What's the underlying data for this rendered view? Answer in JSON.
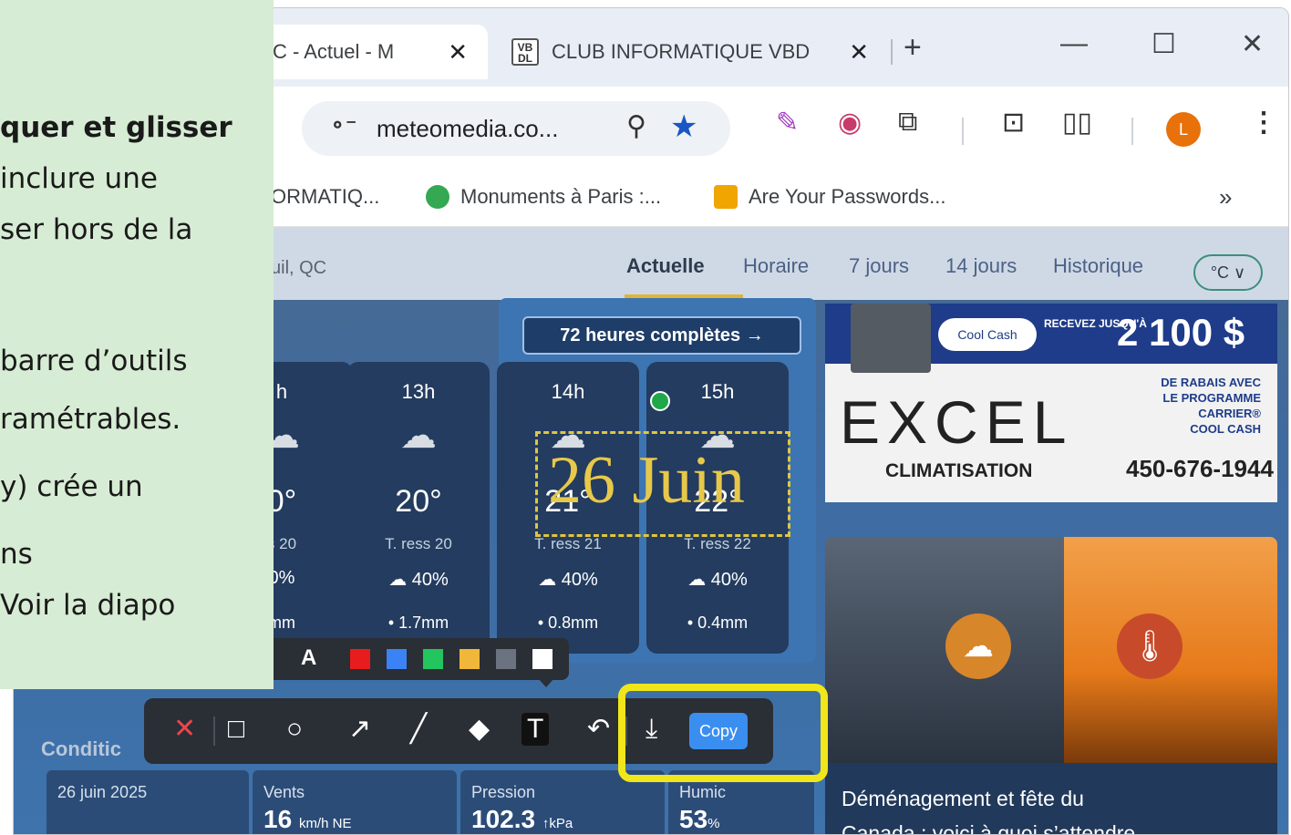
{
  "note": {
    "lines": [
      "quer et glisser",
      "inclure une",
      "ser hors de la",
      "barre d’outils",
      "ramétrables.",
      "y) crée un",
      "ns",
      "Voir la diapo"
    ]
  },
  "browser": {
    "tabs": [
      {
        "label": "C - Actuel - M"
      },
      {
        "label": "CLUB INFORMATIQUE VBD",
        "favicon_text": "VB DL"
      }
    ],
    "close_glyph": "✕",
    "new_tab_glyph": "+",
    "window_controls": {
      "minimize": "—",
      "maximize": "☐",
      "close": "✕"
    },
    "address": "meteomedia.co...",
    "profile_initial": "L",
    "bookmarks": [
      "ORMATIQ...",
      "Monuments à Paris :...",
      "Are Your Passwords..."
    ],
    "more_bookmarks": "»"
  },
  "weather": {
    "location": "uil, QC",
    "nav": [
      "Actuelle",
      "Horaire",
      "7 jours",
      "14 jours",
      "Historique"
    ],
    "unit": "°C ∨",
    "banner": "72 heures complètes →",
    "hours": [
      {
        "hour": "h",
        "temp": "0°",
        "feels": "s 20",
        "precip": "0%",
        "mm": "mm"
      },
      {
        "hour": "13h",
        "temp": "20°",
        "feels": "T. ress 20",
        "precip": "☁ 40%",
        "mm": "• 1.7mm"
      },
      {
        "hour": "14h",
        "temp": "21°",
        "feels": "T. ress 21",
        "precip": "☁ 40%",
        "mm": "• 0.8mm"
      },
      {
        "hour": "15h",
        "temp": "22°",
        "feels": "T. ress 22",
        "precip": "☁ 40%",
        "mm": "• 0.4mm"
      }
    ],
    "conditions_label": "Conditic",
    "date": "26 juin 2025",
    "stats": [
      {
        "label": "Vents",
        "value": "16",
        "unit": "km/h NE"
      },
      {
        "label": "Pression",
        "value": "102.3",
        "unit": "↑kPa"
      },
      {
        "label": "Humic",
        "value": "53",
        "unit": "%"
      }
    ]
  },
  "annotation": {
    "text": "26 Juin"
  },
  "ad1": {
    "coolcash": "Cool Cash",
    "recevez": "RECEVEZ JUSQU'À",
    "amount": "2 100 $",
    "brand": "EXCEL",
    "rabais": [
      "DE RABAIS AVEC",
      "LE PROGRAMME",
      "CARRIER®",
      "COOL CASH"
    ],
    "climatisation": "CLIMATISATION",
    "phone": "450-676-1944"
  },
  "article": {
    "title_line1": "Déménagement et fête du",
    "title_line2": "Canada : voici à quoi s’attendre..."
  },
  "palette": {
    "letters": [
      "A",
      "A"
    ],
    "colors": [
      "#e81c1c",
      "#3b82f6",
      "#22c55e",
      "#f0b73a",
      "#6b7280",
      "#ffffff"
    ]
  },
  "snip_toolbar": {
    "glyphs": {
      "discard": "✕",
      "rect": "□",
      "ellipse": "○",
      "arrow": "↗",
      "pen": "╱",
      "marker": "◆",
      "text": "T",
      "undo": "↶",
      "save": "⤓"
    },
    "copy_label": "Copy"
  }
}
